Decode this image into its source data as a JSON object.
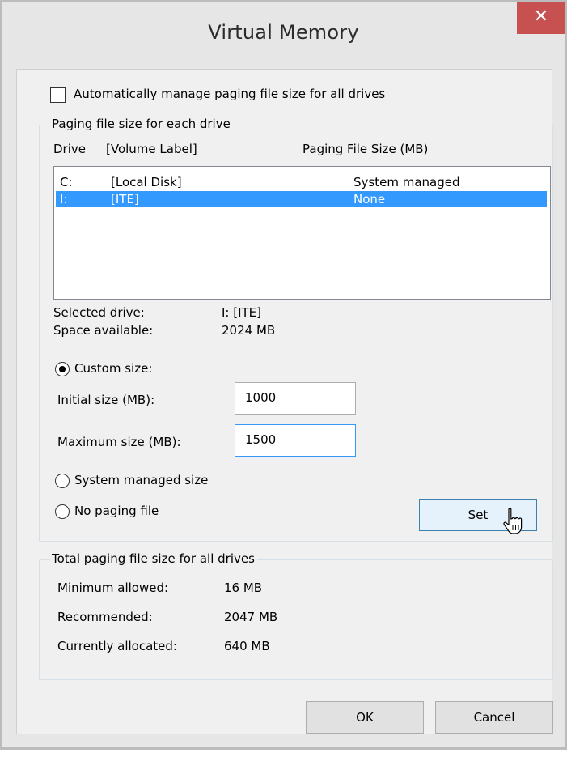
{
  "window": {
    "title": "Virtual Memory",
    "close_glyph": "✕"
  },
  "auto_manage": {
    "label": "Automatically manage paging file size for all drives",
    "checked": false
  },
  "paging_group": {
    "title": "Paging file size for each drive",
    "col_drive": "Drive",
    "col_label": "[Volume Label]",
    "col_size": "Paging File Size (MB)",
    "rows": [
      {
        "drive": "C:",
        "label": "[Local Disk]",
        "size": "System managed",
        "selected": false
      },
      {
        "drive": "I:",
        "label": "[ITE]",
        "size": "None",
        "selected": true
      }
    ],
    "selected_drive_label": "Selected drive:",
    "selected_drive_value": "I:  [ITE]",
    "space_available_label": "Space available:",
    "space_available_value": "2024 MB",
    "custom_size_label": "Custom size:",
    "initial_size_label": "Initial size (MB):",
    "initial_size_value": "1000",
    "maximum_size_label": "Maximum size (MB):",
    "maximum_size_value": "1500",
    "system_managed_label": "System managed size",
    "no_paging_label": "No paging file",
    "selected_option": "custom",
    "set_button": "Set"
  },
  "total_group": {
    "title": "Total paging file size for all drives",
    "minimum_label": "Minimum allowed:",
    "minimum_value": "16 MB",
    "recommended_label": "Recommended:",
    "recommended_value": "2047 MB",
    "allocated_label": "Currently allocated:",
    "allocated_value": "640 MB"
  },
  "footer": {
    "ok": "OK",
    "cancel": "Cancel"
  },
  "colors": {
    "selection": "#3399ff",
    "close": "#c75050",
    "focus_border": "#3399ff"
  }
}
